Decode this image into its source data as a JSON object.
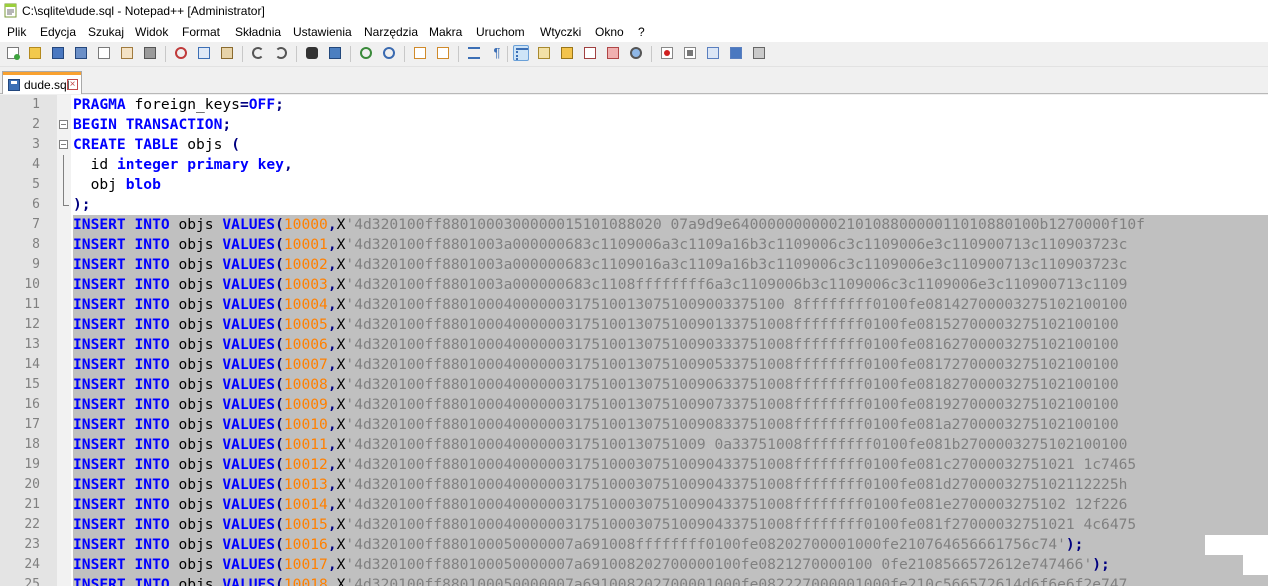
{
  "window": {
    "title": "C:\\sqlite\\dude.sql - Notepad++ [Administrator]"
  },
  "menu": [
    "Plik",
    "Edycja",
    "Szukaj",
    "Widok",
    "Format",
    "Składnia",
    "Ustawienia",
    "Narzędzia",
    "Makra",
    "Uruchom",
    "Wtyczki",
    "Okno",
    "?"
  ],
  "toolbar_icons": [
    "new-file-icon",
    "open-file-icon",
    "save-icon",
    "save-all-icon",
    "close-icon",
    "close-all-icon",
    "print-icon",
    "cut-icon",
    "copy-icon",
    "paste-icon",
    "undo-icon",
    "redo-icon",
    "find-icon",
    "replace-icon",
    "zoom-in-icon",
    "zoom-out-icon",
    "sync-vertical-icon",
    "sync-horizontal-icon",
    "word-wrap-icon",
    "show-all-chars-icon",
    "indent-guide-icon",
    "user-language-icon",
    "document-map-icon",
    "function-list-icon",
    "folder-workspace-icon",
    "monitoring-icon",
    "record-macro-icon",
    "stop-macro-icon",
    "play-macro-icon",
    "run-macro-multiple-icon",
    "save-macro-icon"
  ],
  "tab": {
    "label": "dude.sql"
  },
  "editor": {
    "header_lines": [
      {
        "n": "1",
        "text": "PRAGMA foreign_keys=OFF;"
      },
      {
        "n": "2",
        "text": "BEGIN TRANSACTION;"
      },
      {
        "n": "3",
        "text": "CREATE TABLE objs ("
      },
      {
        "n": "4",
        "text": "  id integer primary key,"
      },
      {
        "n": "5",
        "text": "  obj blob"
      },
      {
        "n": "6",
        "text": ");"
      }
    ],
    "inserts": [
      {
        "n": "7",
        "id": "10000",
        "blob": "'4d320100ff8801000300000015101088020 07a9d9e64000000000021010880000011010880100b1270000f10f"
      },
      {
        "n": "8",
        "id": "10001",
        "blob": "'4d320100ff8801003a000000683c1109006a3c1109a16b3c1109006c3c1109006e3c110900713c110903723c"
      },
      {
        "n": "9",
        "id": "10002",
        "blob": "'4d320100ff8801003a000000683c1109016a3c1109a16b3c1109006c3c1109006e3c110900713c110903723c"
      },
      {
        "n": "10",
        "id": "10003",
        "blob": "'4d320100ff8801003a000000683c1108ffffffff6a3c1109006b3c1109006c3c1109006e3c110900713c1109"
      },
      {
        "n": "11",
        "id": "10004",
        "blob": "'4d320100ff880100040000003175100130751009003375100 8ffffffff0100fe08142700003275102100100"
      },
      {
        "n": "12",
        "id": "10005",
        "blob": "'4d320100ff8801000400000031751001307510090133751008ffffffff0100fe08152700003275102100100"
      },
      {
        "n": "13",
        "id": "10006",
        "blob": "'4d320100ff8801000400000031751001307510090333751008ffffffff0100fe08162700003275102100100"
      },
      {
        "n": "14",
        "id": "10007",
        "blob": "'4d320100ff8801000400000031751001307510090533751008ffffffff0100fe08172700003275102100100"
      },
      {
        "n": "15",
        "id": "10008",
        "blob": "'4d320100ff8801000400000031751001307510090633751008ffffffff0100fe08182700003275102100100"
      },
      {
        "n": "16",
        "id": "10009",
        "blob": "'4d320100ff8801000400000031751001307510090733751008ffffffff0100fe08192700003275102100100"
      },
      {
        "n": "17",
        "id": "10010",
        "blob": "'4d320100ff8801000400000031751001307510090833751008ffffffff0100fe081a2700003275102100100"
      },
      {
        "n": "18",
        "id": "10011",
        "blob": "'4d320100ff880100040000003175100130751009 0a33751008ffffffff0100fe081b2700003275102100100"
      },
      {
        "n": "19",
        "id": "10012",
        "blob": "'4d320100ff8801000400000031751000307510090433751008ffffffff0100fe081c27000032751021 1c7465"
      },
      {
        "n": "20",
        "id": "10013",
        "blob": "'4d320100ff8801000400000031751000307510090433751008ffffffff0100fe081d2700003275102112225h"
      },
      {
        "n": "21",
        "id": "10014",
        "blob": "'4d320100ff8801000400000031751000307510090433751008ffffffff0100fe081e2700003275102 12f226"
      },
      {
        "n": "22",
        "id": "10015",
        "blob": "'4d320100ff8801000400000031751000307510090433751008ffffffff0100fe081f27000032751021 4c6475"
      },
      {
        "n": "23",
        "id": "10016",
        "blob": "'4d320100ff880100050000007a691008ffffffff0100fe08202700001000fe210764656661756c74'",
        "end": ");"
      },
      {
        "n": "24",
        "id": "10017",
        "blob": "'4d320100ff880100050000007a691008202700000100fe0821270000100 0fe2108566572612e747466'",
        "end": ");"
      },
      {
        "n": "25",
        "id": "10018",
        "blob": "'4d320100ff880100050000007a691008202700001000fe082227000001000fe210c566572614d6f6e6f2e747"
      }
    ]
  }
}
